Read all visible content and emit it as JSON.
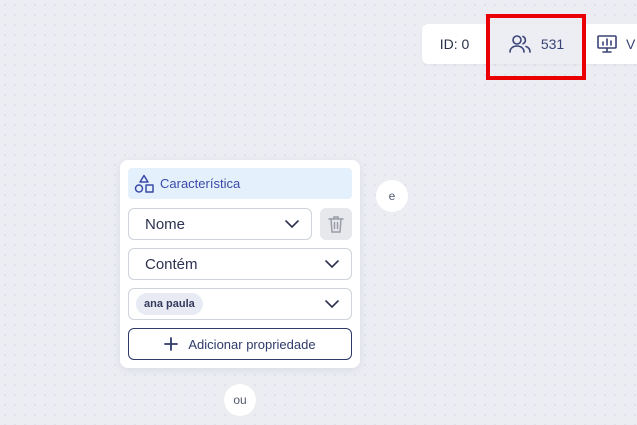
{
  "toolbar": {
    "id_label": "ID: 0",
    "audience_count": "531",
    "present_label": "V"
  },
  "card": {
    "header_label": "Característica",
    "property_select": "Nome",
    "operator_select": "Contém",
    "value_chip": "ana paula",
    "add_property_label": "Adicionar propriedade"
  },
  "connectors": {
    "and_label": "e",
    "or_label": "ou"
  },
  "colors": {
    "accent": "#3a4aa7",
    "highlight": "#ea0000",
    "header_bg": "#e5f0fd"
  },
  "icons": [
    "users-icon",
    "presentation-icon",
    "shapes-icon",
    "chevron-down-icon",
    "trash-icon",
    "plus-icon"
  ]
}
